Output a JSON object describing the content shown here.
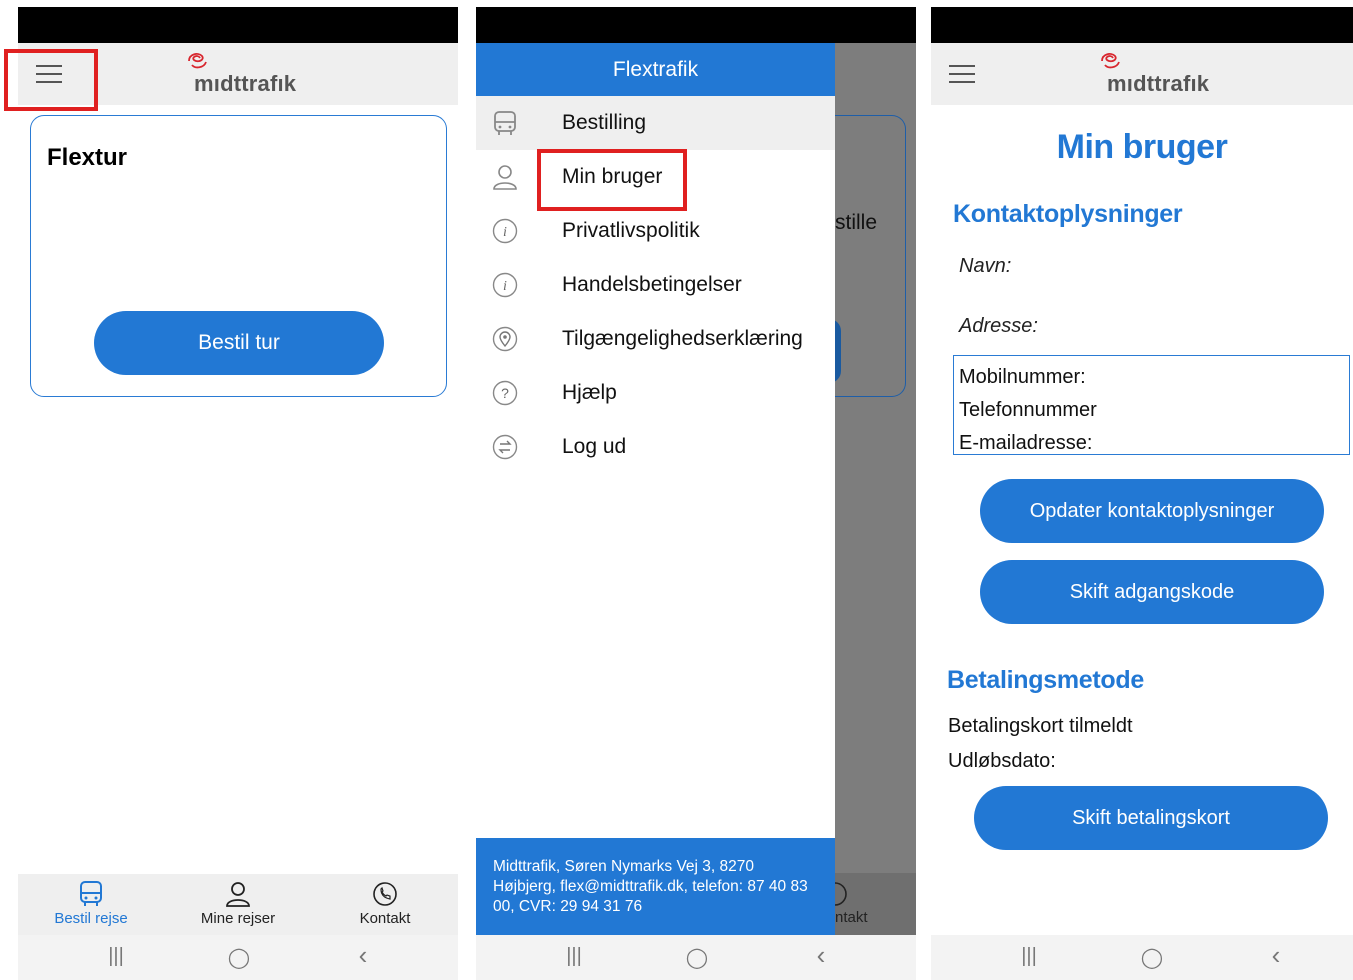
{
  "screen1": {
    "logo_text": "mıdttrafık",
    "card_title": "Flextur",
    "book_button": "Bestil tur",
    "tabs": [
      {
        "label": "Bestil rejse",
        "icon": "bus-icon",
        "active": true
      },
      {
        "label": "Mine rejser",
        "icon": "user-icon",
        "active": false
      },
      {
        "label": "Kontakt",
        "icon": "phone-icon",
        "active": false
      }
    ]
  },
  "screen2": {
    "drawer_title": "Flextrafik",
    "behind_text_1": "stille",
    "behind_text_2": "ntakt",
    "menu": [
      {
        "label": "Bestilling",
        "icon": "bus-icon"
      },
      {
        "label": "Min bruger",
        "icon": "user-icon"
      },
      {
        "label": "Privatlivspolitik",
        "icon": "info-icon"
      },
      {
        "label": "Handelsbetingelser",
        "icon": "info-icon"
      },
      {
        "label": "Tilgængelighedserklæring",
        "icon": "location-pin-icon"
      },
      {
        "label": "Hjælp",
        "icon": "help-icon"
      },
      {
        "label": "Log ud",
        "icon": "logout-icon"
      }
    ],
    "footer": "Midttrafik, Søren Nymarks Vej 3, 8270 Højbjerg, flex@midttrafik.dk, telefon: 87 40 83 00, CVR: 29 94 31 76"
  },
  "screen3": {
    "logo_text": "mıdttrafık",
    "title": "Min bruger",
    "contact_heading": "Kontaktoplysninger",
    "name_label": "Navn:",
    "address_label": "Adresse:",
    "mobile_label": "Mobilnummer:",
    "phone_label": "Telefonnummer",
    "email_label": "E-mailadresse:",
    "update_button": "Opdater kontaktoplysninger",
    "password_button": "Skift adgangskode",
    "payment_heading": "Betalingsmetode",
    "card_status": "Betalingskort tilmeldt",
    "expiry_label": "Udløbsdato:",
    "change_card_button": "Skift betalingskort"
  },
  "system_nav": {
    "recent": "|||",
    "home": "◯",
    "back": "‹"
  },
  "colors": {
    "accent": "#2278d4",
    "highlight": "#e02020",
    "logo_red": "#d8262e"
  }
}
